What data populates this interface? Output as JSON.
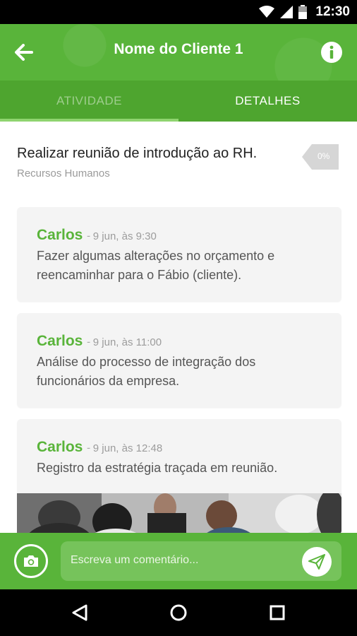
{
  "status_bar": {
    "time": "12:30"
  },
  "app_bar": {
    "title": "Nome do Cliente 1"
  },
  "tabs": [
    {
      "label": "ATIVIDADE",
      "active": false
    },
    {
      "label": "DETALHES",
      "active": true
    }
  ],
  "task": {
    "title": "Realizar reunião de introdução ao RH.",
    "subtitle": "Recursos Humanos",
    "progress": "0%"
  },
  "comments": [
    {
      "author": "Carlos",
      "time": "9 jun, às 9:30",
      "text": "Fazer algumas alterações no orçamento e reencaminhar para o Fábio (cliente)."
    },
    {
      "author": "Carlos",
      "time": "9 jun, às 11:00",
      "text": "Análise do processo de integração dos funcionários da empresa."
    },
    {
      "author": "Carlos",
      "time": "9 jun, às 12:48",
      "text": "Registro da estratégia traçada em reunião."
    }
  ],
  "comment_bar": {
    "placeholder": "Escreva um comentário..."
  },
  "colors": {
    "primary": "#59b43a",
    "primary_dark": "#4ea52f",
    "accent_indicator": "#8fd46f"
  },
  "icons": [
    "back-arrow-icon",
    "info-icon",
    "camera-icon",
    "send-icon",
    "wifi-icon",
    "signal-icon",
    "battery-icon",
    "nav-back-icon",
    "nav-home-icon",
    "nav-recents-icon"
  ]
}
